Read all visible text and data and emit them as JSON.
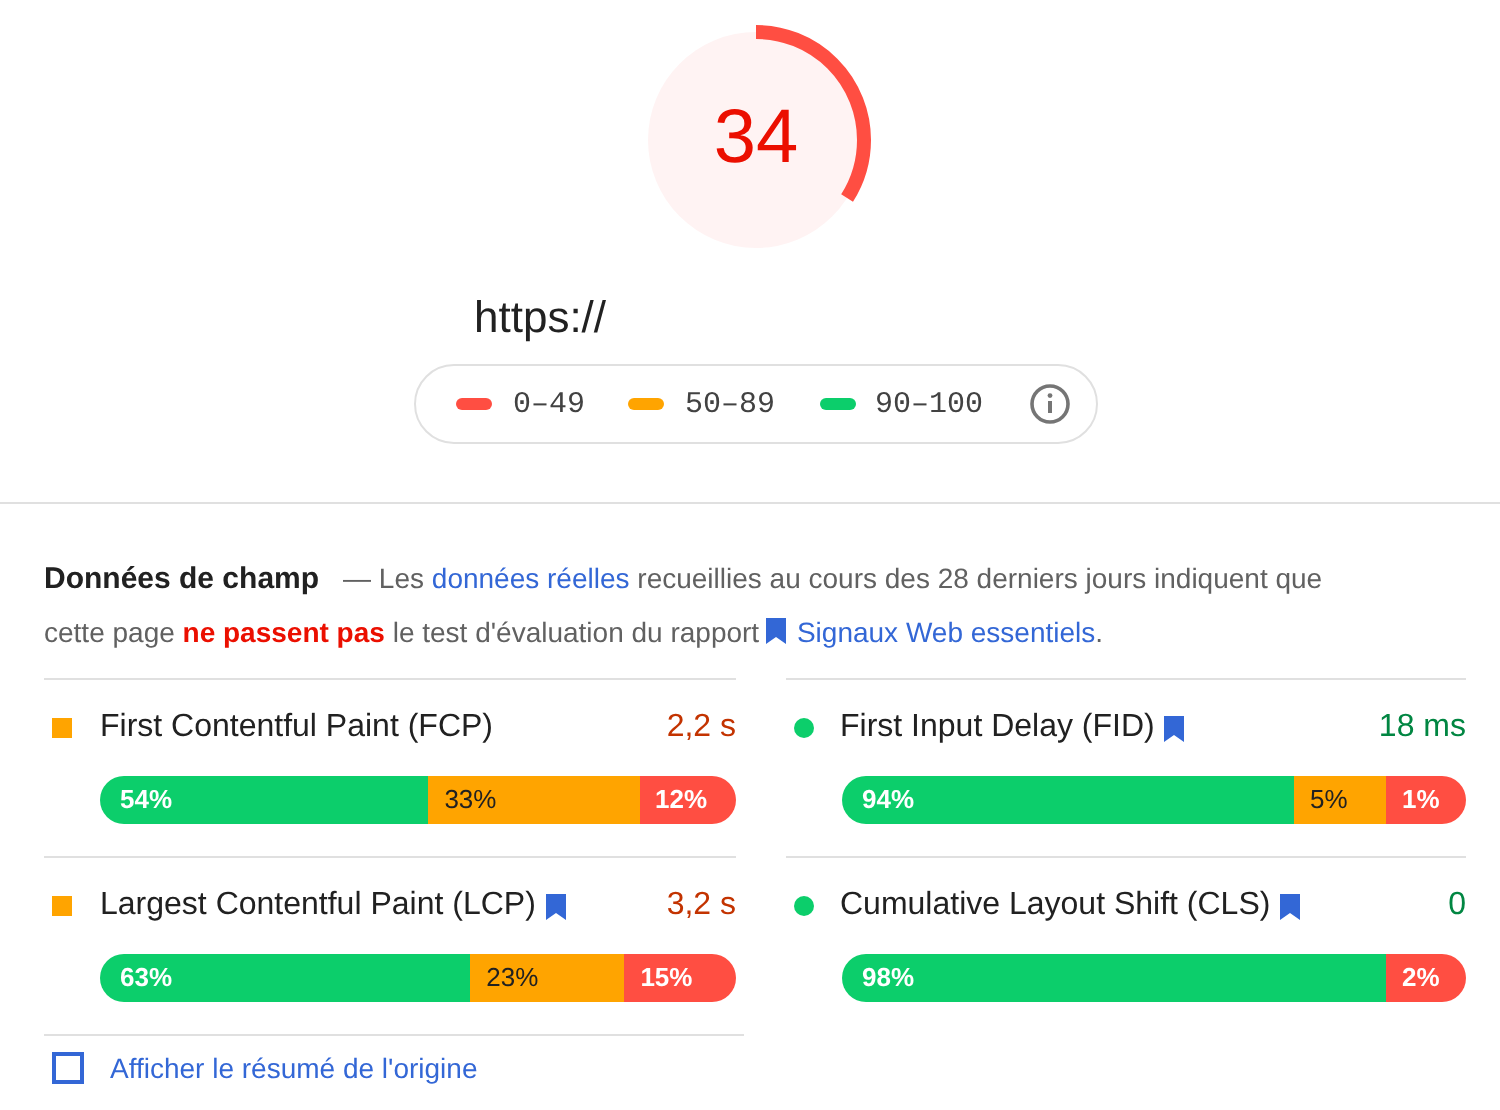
{
  "score": {
    "value": "34",
    "level": 0.34
  },
  "url": "https://",
  "legend": [
    {
      "kind": "fail",
      "label": "0–49"
    },
    {
      "kind": "average",
      "label": "50–89"
    },
    {
      "kind": "pass",
      "label": "90–100"
    }
  ],
  "field_data": {
    "title": "Données de champ",
    "description": [
      {
        "kind": "text",
        "text": "— Les "
      },
      {
        "kind": "link",
        "text": "données réelles"
      },
      {
        "kind": "text",
        "text": " recueillies au cours des 28 derniers jours indiquent que cette page "
      },
      {
        "kind": "fail",
        "text": "ne passent pas"
      },
      {
        "kind": "text",
        "text": " le test d'évaluation du rapport "
      },
      {
        "kind": "bookmark_link",
        "text": "Signaux Web essentiels"
      },
      {
        "kind": "text",
        "text": "."
      }
    ],
    "metrics": [
      {
        "name": "First Contentful Paint (FCP)",
        "kind": "average",
        "bookmark": false,
        "value": "2,2 s",
        "distribution": [
          {
            "kind": "pass",
            "label": "54%"
          },
          {
            "kind": "average",
            "label": "33%"
          },
          {
            "kind": "fail",
            "label": "12%"
          }
        ]
      },
      {
        "name": "First Input Delay (FID)",
        "kind": "pass",
        "bookmark": true,
        "value": "18 ms",
        "distribution": [
          {
            "kind": "pass",
            "label": "94%"
          },
          {
            "kind": "average",
            "label": "5%"
          },
          {
            "kind": "fail",
            "label": "1%"
          }
        ]
      },
      {
        "name": "Largest Contentful Paint (LCP)",
        "kind": "average",
        "bookmark": true,
        "value": "3,2 s",
        "distribution": [
          {
            "kind": "pass",
            "label": "63%"
          },
          {
            "kind": "average",
            "label": "23%"
          },
          {
            "kind": "fail",
            "label": "15%"
          }
        ]
      },
      {
        "name": "Cumulative Layout Shift (CLS)",
        "kind": "pass",
        "bookmark": true,
        "value": "0",
        "distribution": [
          {
            "kind": "pass",
            "label": "98%"
          },
          {
            "kind": "fail",
            "label": "2%"
          }
        ]
      }
    ],
    "origin_summary": {
      "label": "Afficher le résumé de l'origine",
      "checked": false
    }
  }
}
